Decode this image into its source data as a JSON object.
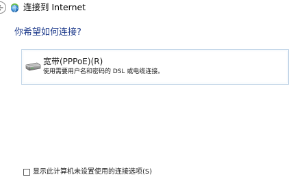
{
  "window": {
    "title": "连接到 Internet",
    "back_icon": "back-arrow-icon",
    "title_icon": "network-globe-icon"
  },
  "main": {
    "question": "你希望如何连接?",
    "options": [
      {
        "title": "宽带(PPPoE)(R)",
        "description": "使用需要用户名和密码的 DSL 或电缆连接。",
        "icon": "broadband-modem-icon"
      }
    ]
  },
  "footer": {
    "show_unconfigured_label": "显示此计算机未设置使用的连接选项(S)",
    "show_unconfigured_checked": false
  },
  "colors": {
    "heading": "#1e3b8c",
    "card_border": "#c3d6e8"
  }
}
